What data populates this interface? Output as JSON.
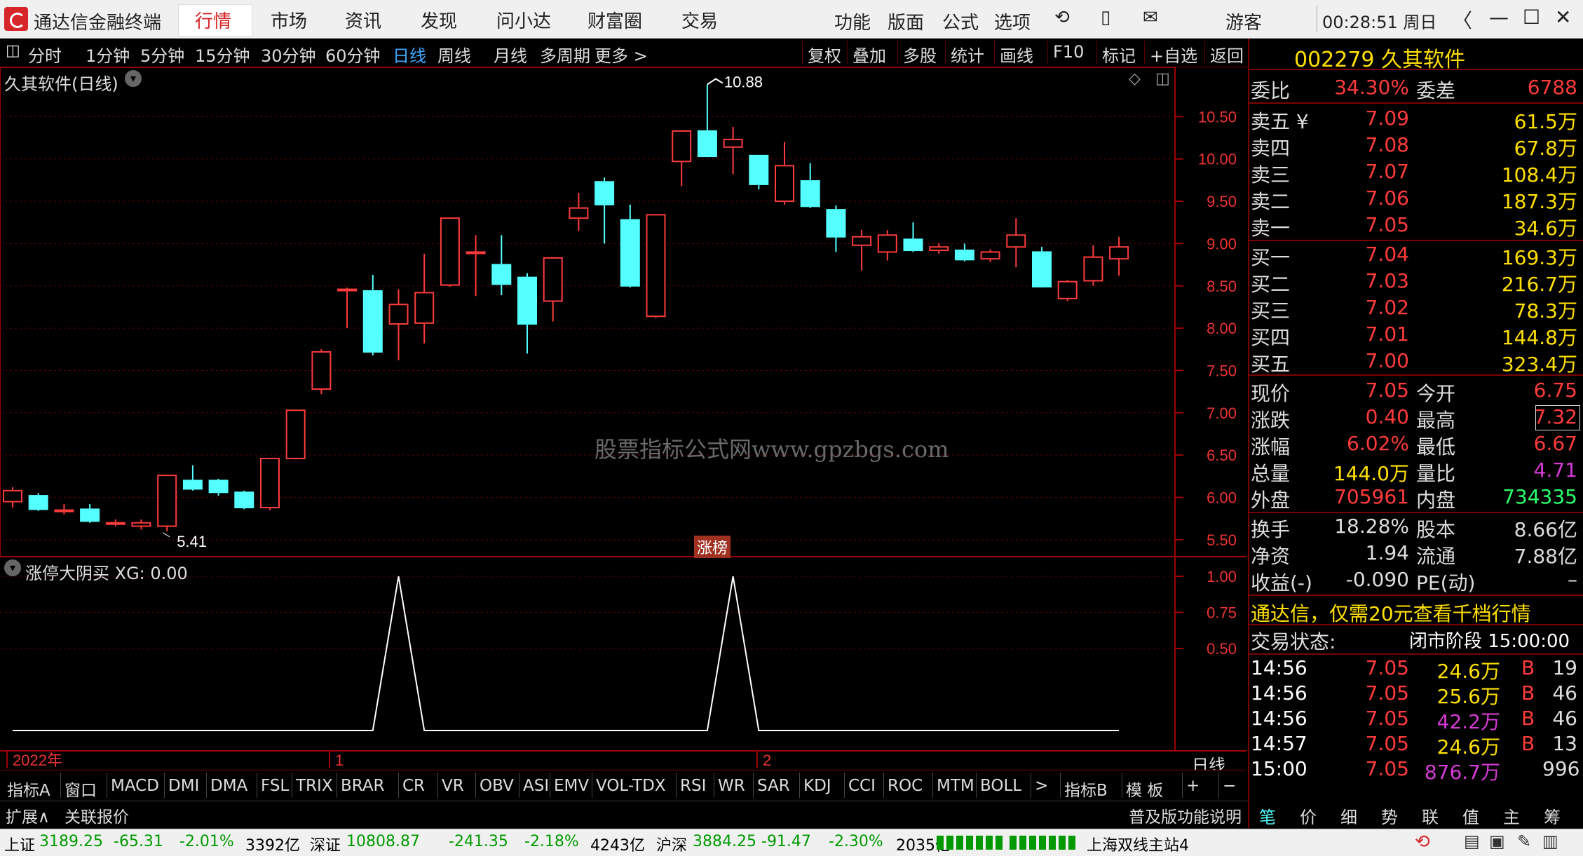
{
  "app": {
    "title": "通达信金融终端"
  },
  "menu": [
    "行情",
    "市场",
    "资讯",
    "发现",
    "问小达",
    "财富圈",
    "交易"
  ],
  "menu_active": "行情",
  "sys_menu": [
    "功能",
    "版面",
    "公式",
    "选项"
  ],
  "account": "游客",
  "clock": "00:28:51 周日",
  "period_tabs": [
    "分时",
    "1分钟",
    "5分钟",
    "15分钟",
    "30分钟",
    "60分钟",
    "日线",
    "周线",
    "月线",
    "多周期",
    "更多 >"
  ],
  "period_selected": "日线",
  "tool_tabs": [
    "复权",
    "叠加",
    "多股",
    "统计",
    "画线",
    "F10",
    "标记",
    "+自选",
    "返回"
  ],
  "chart": {
    "title": "久其软件(日线)",
    "watermark": "股票指标公式网www.gpzbgs.com",
    "high_mark": "10.88",
    "low_mark": "5.41",
    "tag": "涨榜",
    "y_ticks": [
      "10.50",
      "10.00",
      "9.50",
      "9.00",
      "8.50",
      "8.00",
      "7.50",
      "7.00",
      "6.50",
      "6.00",
      "5.50"
    ],
    "indicator_title": "涨停大阴买  XG: 0.00",
    "ind_ticks": [
      "1.00",
      "0.75",
      "0.50"
    ],
    "x_labels": [
      "2022年",
      "1",
      "2"
    ],
    "period_label": "日线"
  },
  "chart_data": {
    "type": "candlestick",
    "candles": [
      {
        "o": 5.95,
        "c": 6.08,
        "h": 6.12,
        "l": 5.88
      },
      {
        "o": 6.02,
        "c": 5.86,
        "h": 6.05,
        "l": 5.84
      },
      {
        "o": 5.85,
        "c": 5.85,
        "h": 5.92,
        "l": 5.8
      },
      {
        "o": 5.86,
        "c": 5.72,
        "h": 5.92,
        "l": 5.7
      },
      {
        "o": 5.7,
        "c": 5.7,
        "h": 5.74,
        "l": 5.66
      },
      {
        "o": 5.66,
        "c": 5.7,
        "h": 5.74,
        "l": 5.62
      },
      {
        "o": 5.66,
        "c": 6.26,
        "h": 6.26,
        "l": 5.6
      },
      {
        "o": 6.2,
        "c": 6.1,
        "h": 6.38,
        "l": 6.08
      },
      {
        "o": 6.2,
        "c": 6.06,
        "h": 6.22,
        "l": 6.02
      },
      {
        "o": 6.06,
        "c": 5.88,
        "h": 6.08,
        "l": 5.86
      },
      {
        "o": 5.88,
        "c": 6.46,
        "h": 6.46,
        "l": 5.85
      },
      {
        "o": 6.46,
        "c": 7.03,
        "h": 7.03,
        "l": 6.45
      },
      {
        "o": 7.28,
        "c": 7.72,
        "h": 7.75,
        "l": 7.22
      },
      {
        "o": 8.46,
        "c": 8.46,
        "h": 8.48,
        "l": 8.0
      },
      {
        "o": 8.44,
        "c": 7.72,
        "h": 8.63,
        "l": 7.68
      },
      {
        "o": 8.05,
        "c": 8.28,
        "h": 8.46,
        "l": 7.62
      },
      {
        "o": 8.06,
        "c": 8.42,
        "h": 8.88,
        "l": 7.82
      },
      {
        "o": 8.51,
        "c": 9.3,
        "h": 9.3,
        "l": 8.49
      },
      {
        "o": 8.9,
        "c": 8.9,
        "h": 9.1,
        "l": 8.38
      },
      {
        "o": 8.75,
        "c": 8.52,
        "h": 9.1,
        "l": 8.39
      },
      {
        "o": 8.6,
        "c": 8.05,
        "h": 8.65,
        "l": 7.7
      },
      {
        "o": 8.32,
        "c": 8.83,
        "h": 8.84,
        "l": 8.08
      },
      {
        "o": 9.3,
        "c": 9.42,
        "h": 9.6,
        "l": 9.15
      },
      {
        "o": 9.73,
        "c": 9.46,
        "h": 9.78,
        "l": 9.0
      },
      {
        "o": 9.28,
        "c": 8.5,
        "h": 9.46,
        "l": 8.48
      },
      {
        "o": 8.14,
        "c": 9.34,
        "h": 9.34,
        "l": 8.12
      },
      {
        "o": 9.97,
        "c": 10.33,
        "h": 10.33,
        "l": 9.68
      },
      {
        "o": 10.33,
        "c": 10.03,
        "h": 10.88,
        "l": 10.03
      },
      {
        "o": 10.14,
        "c": 10.23,
        "h": 10.38,
        "l": 9.82
      },
      {
        "o": 10.04,
        "c": 9.7,
        "h": 10.04,
        "l": 9.64
      },
      {
        "o": 9.5,
        "c": 9.92,
        "h": 10.2,
        "l": 9.46
      },
      {
        "o": 9.74,
        "c": 9.44,
        "h": 9.95,
        "l": 9.42
      },
      {
        "o": 9.4,
        "c": 9.08,
        "h": 9.45,
        "l": 8.9
      },
      {
        "o": 8.98,
        "c": 9.08,
        "h": 9.16,
        "l": 8.68
      },
      {
        "o": 8.9,
        "c": 9.1,
        "h": 9.16,
        "l": 8.8
      },
      {
        "o": 9.05,
        "c": 8.92,
        "h": 9.25,
        "l": 8.9
      },
      {
        "o": 8.92,
        "c": 8.96,
        "h": 9.0,
        "l": 8.88
      },
      {
        "o": 8.92,
        "c": 8.81,
        "h": 9.0,
        "l": 8.79
      },
      {
        "o": 8.82,
        "c": 8.9,
        "h": 8.93,
        "l": 8.78
      },
      {
        "o": 8.96,
        "c": 9.1,
        "h": 9.3,
        "l": 8.72
      },
      {
        "o": 8.9,
        "c": 8.49,
        "h": 8.96,
        "l": 8.48
      },
      {
        "o": 8.35,
        "c": 8.55,
        "h": 8.57,
        "l": 8.32
      },
      {
        "o": 8.56,
        "c": 8.84,
        "h": 8.98,
        "l": 8.5
      },
      {
        "o": 8.82,
        "c": 8.96,
        "h": 9.08,
        "l": 8.62
      }
    ],
    "signal_peaks": [
      15,
      28
    ],
    "ylim": [
      5.3,
      11.0
    ]
  },
  "quote": {
    "code_name": "002279 久其软件",
    "weibi_label": "委比",
    "weibi": "34.30%",
    "weicha_label": "委差",
    "weicha": "6788",
    "sells": [
      {
        "label": "卖五 ¥",
        "price": "7.09",
        "vol": "61.5万"
      },
      {
        "label": "卖四",
        "price": "7.08",
        "vol": "67.8万"
      },
      {
        "label": "卖三",
        "price": "7.07",
        "vol": "108.4万"
      },
      {
        "label": "卖二",
        "price": "7.06",
        "vol": "187.3万"
      },
      {
        "label": "卖一",
        "price": "7.05",
        "vol": "34.6万"
      }
    ],
    "buys": [
      {
        "label": "买一",
        "price": "7.04",
        "vol": "169.3万"
      },
      {
        "label": "买二",
        "price": "7.03",
        "vol": "216.7万"
      },
      {
        "label": "买三",
        "price": "7.02",
        "vol": "78.3万"
      },
      {
        "label": "买四",
        "price": "7.01",
        "vol": "144.8万"
      },
      {
        "label": "买五",
        "price": "7.00",
        "vol": "323.4万"
      }
    ],
    "stats": [
      {
        "l1": "现价",
        "v1": "7.05",
        "c1": "#ff3b3b",
        "l2": "今开",
        "v2": "6.75",
        "c2": "#ff3b3b"
      },
      {
        "l1": "涨跌",
        "v1": "0.40",
        "c1": "#ff3b3b",
        "l2": "最高",
        "v2": "7.32",
        "c2": "#ff3b3b"
      },
      {
        "l1": "涨幅",
        "v1": "6.02%",
        "c1": "#ff3b3b",
        "l2": "最低",
        "v2": "6.67",
        "c2": "#ff3b3b"
      },
      {
        "l1": "总量",
        "v1": "144.0万",
        "c1": "#ffe000",
        "l2": "量比",
        "v2": "4.71",
        "c2": "#d63bd6"
      },
      {
        "l1": "外盘",
        "v1": "705961",
        "c1": "#ff3b3b",
        "l2": "内盘",
        "v2": "734335",
        "c2": "#2bff6a"
      }
    ],
    "stats2": [
      {
        "l1": "换手",
        "v1": "18.28%",
        "l2": "股本",
        "v2": "8.66亿"
      },
      {
        "l1": "净资",
        "v1": "1.94",
        "l2": "流通",
        "v2": "7.88亿"
      },
      {
        "l1": "收益(-)",
        "v1": "-0.090",
        "l2": "PE(动)",
        "v2": "–"
      }
    ],
    "promo": "通达信，仅需20元查看千档行情",
    "trade_status_label": "交易状态:",
    "trade_status": "闭市阶段 15:00:00",
    "ticks": [
      {
        "t": "14:56",
        "p": "7.05",
        "v": "24.6万",
        "vc": "#ffe000",
        "bs": "B",
        "n": "19"
      },
      {
        "t": "14:56",
        "p": "7.05",
        "v": "25.6万",
        "vc": "#ffe000",
        "bs": "B",
        "n": "46"
      },
      {
        "t": "14:56",
        "p": "7.05",
        "v": "42.2万",
        "vc": "#d63bd6",
        "bs": "B",
        "n": "46"
      },
      {
        "t": "14:57",
        "p": "7.05",
        "v": "24.6万",
        "vc": "#ffe000",
        "bs": "B",
        "n": "13"
      },
      {
        "t": "15:00",
        "p": "7.05",
        "v": "876.7万",
        "vc": "#d63bd6",
        "bs": "",
        "n": "996"
      }
    ]
  },
  "indicators": [
    "指标A",
    "窗口",
    "MACD",
    "DMI",
    "DMA",
    "FSL",
    "TRIX",
    "BRAR",
    "CR",
    "VR",
    "OBV",
    "ASI",
    "EMV",
    "VOL-TDX",
    "RSI",
    "WR",
    "SAR",
    "KDJ",
    "CCI",
    "ROC",
    "MTM",
    "BOLL",
    ">",
    "指标B",
    "模 板",
    "+",
    "−"
  ],
  "bottom_left": [
    "扩展∧",
    "关联报价"
  ],
  "bottom_right_label": "普及版功能说明",
  "side_tabs": [
    "笔",
    "价",
    "细",
    "势",
    "联",
    "值",
    "主",
    "筹"
  ],
  "status": {
    "sh_label": "上证",
    "sh_val": "3189.25",
    "sh_chg": "-65.31",
    "sh_pct": "-2.01%",
    "sh_amt": "3392亿",
    "sz_label": "深证",
    "sz_val": "10808.87",
    "sz_chg": "-241.35",
    "sz_pct": "-2.18%",
    "sz_amt": "4243亿",
    "hs_label": "沪深",
    "hs_val": "3884.25",
    "hs_chg": "-91.47",
    "hs_pct": "-2.30%",
    "hs_amt": "2035亿",
    "server": "上海双线主站4"
  }
}
